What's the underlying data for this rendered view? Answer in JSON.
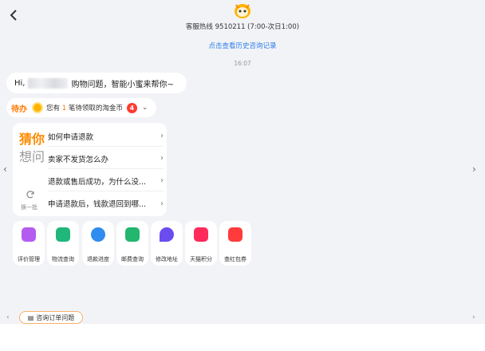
{
  "header": {
    "hotline": "客服热线 9510211 (7:00-次日1:00)"
  },
  "chat": {
    "history_link": "点击查看历史咨询记录",
    "timestamp": "16:07",
    "greeting_prefix": "Hi,",
    "greeting_suffix": "购物问题，智能小蜜来帮你~"
  },
  "todo": {
    "tag": "待办",
    "text_before": "您有",
    "count": "1",
    "text_after": "笔待领取的淘金币",
    "badge": "4"
  },
  "guess": {
    "title_line1": "猜你",
    "title_line2": "想问",
    "refresh_label": "换一批",
    "questions": [
      "如何申请退款",
      "卖家不发货怎么办",
      "退款或售后成功，为什么没...",
      "申请退款后，钱款退回到哪..."
    ]
  },
  "shortcuts": [
    {
      "label": "评价管理",
      "icon": "review-icon",
      "color": "#b45cf0"
    },
    {
      "label": "物流查询",
      "icon": "truck-icon",
      "color": "#1fb77a"
    },
    {
      "label": "退款进度",
      "icon": "refund-icon",
      "color": "#2f8cf0"
    },
    {
      "label": "邮费查询",
      "icon": "postage-icon",
      "color": "#22b66e"
    },
    {
      "label": "修改地址",
      "icon": "location-icon",
      "color": "#6a4cf0"
    },
    {
      "label": "天猫积分",
      "icon": "tmall-points-icon",
      "color": "#ff2b5a"
    },
    {
      "label": "查红包券",
      "icon": "red-packet-icon",
      "color": "#ff3b3b"
    }
  ],
  "bottom": {
    "consult_chip": "咨询订单问题"
  },
  "colors": {
    "accent_orange": "#ff8a00",
    "link_blue": "#2f7fe8",
    "badge_red": "#ff3b30",
    "background": "#f2f3f7"
  }
}
